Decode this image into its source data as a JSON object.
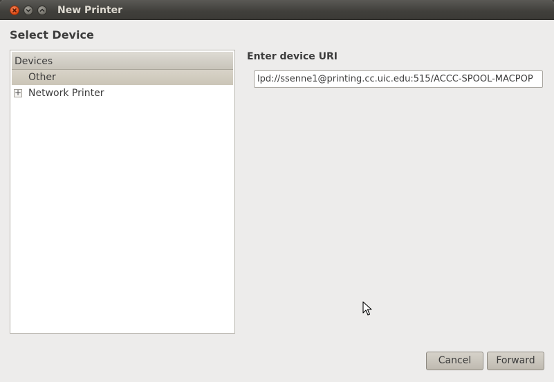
{
  "window": {
    "title": "New Printer",
    "controls": [
      "close-icon",
      "minimize-icon",
      "maximize-icon"
    ]
  },
  "page": {
    "heading": "Select Device"
  },
  "devices": {
    "header": "Devices",
    "items": [
      {
        "label": "Other",
        "selected": true,
        "expandable": false
      },
      {
        "label": "Network Printer",
        "selected": false,
        "expandable": true,
        "expander_glyph": "+"
      }
    ]
  },
  "uri": {
    "label": "Enter device URI",
    "value": "lpd://ssenne1@printing.cc.uic.edu:515/ACCC-SPOOL-MACPOP"
  },
  "buttons": {
    "cancel": "Cancel",
    "forward": "Forward"
  },
  "colors": {
    "titlebar": "#403f3b",
    "close_button": "#df4a15",
    "window_bg": "#edeceb",
    "selection": "#cbc5b7"
  }
}
